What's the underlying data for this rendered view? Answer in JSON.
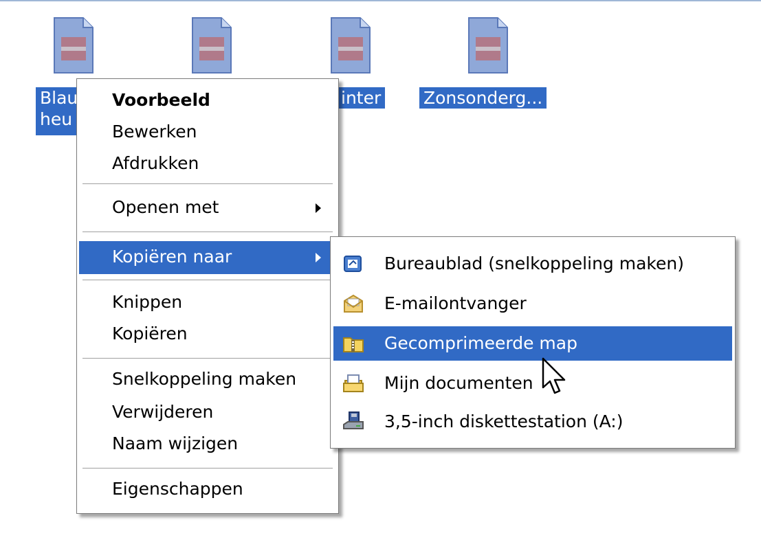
{
  "files": [
    {
      "label": "Blau"
    },
    {
      "label": ""
    },
    {
      "label": "inter"
    },
    {
      "label": "Zonsonderg..."
    }
  ],
  "file_label_line2": "heu",
  "icons": {
    "file": "image-file-icon",
    "desktop": "desktop-shortcut-icon",
    "mail": "mail-envelope-icon",
    "zip": "zip-folder-icon",
    "documents": "my-documents-icon",
    "floppy": "floppy-drive-icon",
    "submenu_arrow": "submenu-arrow-icon",
    "cursor": "mouse-cursor-icon"
  },
  "colors": {
    "highlight": "#316ac5",
    "menu_bg": "#ffffff"
  },
  "context_menu": {
    "items": [
      {
        "label": "Voorbeeld"
      },
      {
        "label": "Bewerken"
      },
      {
        "label": "Afdrukken"
      },
      {
        "label": "Openen met"
      },
      {
        "label": "Kopiëren naar"
      },
      {
        "label": "Knippen"
      },
      {
        "label": "Kopiëren"
      },
      {
        "label": "Snelkoppeling maken"
      },
      {
        "label": "Verwijderen"
      },
      {
        "label": "Naam wijzigen"
      },
      {
        "label": "Eigenschappen"
      }
    ]
  },
  "submenu": {
    "items": [
      {
        "label": "Bureaublad (snelkoppeling maken)"
      },
      {
        "label": "E-mailontvanger"
      },
      {
        "label": "Gecomprimeerde map"
      },
      {
        "label": "Mijn documenten"
      },
      {
        "label": "3,5-inch diskettestation (A:)"
      }
    ]
  }
}
